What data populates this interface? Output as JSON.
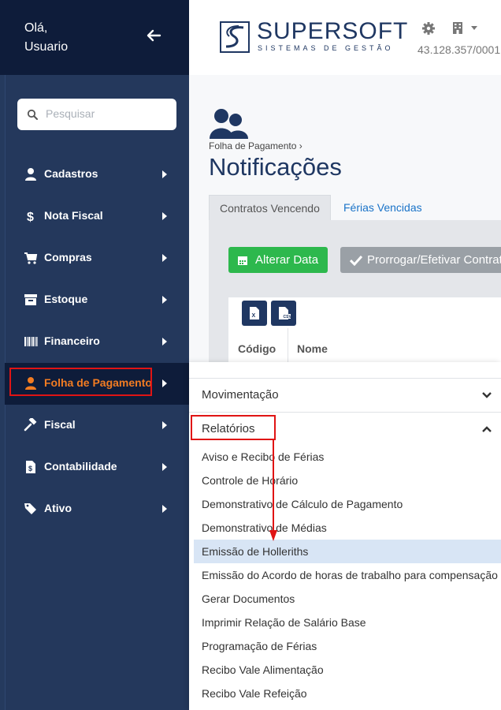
{
  "sidebar": {
    "greeting_line1": "Olá,",
    "greeting_line2": "Usuario",
    "search_placeholder": "Pesquisar",
    "items": [
      {
        "label": "Cadastros",
        "icon": "user-icon"
      },
      {
        "label": "Nota Fiscal",
        "icon": "dollar-icon"
      },
      {
        "label": "Compras",
        "icon": "cart-icon"
      },
      {
        "label": "Estoque",
        "icon": "archive-icon"
      },
      {
        "label": "Financeiro",
        "icon": "barcode-icon"
      },
      {
        "label": "Folha de Pagamento",
        "icon": "user-icon",
        "active": true
      },
      {
        "label": "Fiscal",
        "icon": "gavel-icon"
      },
      {
        "label": "Contabilidade",
        "icon": "file-dollar-icon"
      },
      {
        "label": "Ativo",
        "icon": "tags-icon"
      }
    ]
  },
  "header": {
    "brand": "SUPERSOFT",
    "brand_sub": "SISTEMAS DE GESTÃO",
    "company_id": "43.128.357/0001"
  },
  "main": {
    "breadcrumb": "Folha de Pagamento",
    "title": "Notificações",
    "tabs": [
      {
        "label": "Contratos Vencendo",
        "active": true
      },
      {
        "label": "Férias Vencidas",
        "active": false
      }
    ],
    "buttons": {
      "alter_date": "Alterar Data",
      "extend": "Prorrogar/Efetivar Contrat"
    },
    "table_headers": [
      "Código",
      "Nome"
    ]
  },
  "submenu": {
    "sections": [
      {
        "label": "Movimentação",
        "expanded": false
      },
      {
        "label": "Relatórios",
        "expanded": true
      }
    ],
    "links": [
      "Aviso e Recibo de Férias",
      "Controle de Horário",
      "Demonstrativo de Cálculo de Pagamento",
      "Demonstrativo de Médias",
      "Emissão de Holleriths",
      "Emissão do Acordo de horas de trabalho para compensação",
      "Gerar Documentos",
      "Imprimir Relação de Salário Base",
      "Programação de Férias",
      "Recibo Vale Alimentação",
      "Recibo Vale Refeição"
    ],
    "highlighted_index": 4
  },
  "colors": {
    "sidebar": "#24385c",
    "sidebar_dark": "#0e1c3a",
    "active_label": "#f27c22",
    "brand": "#1f3762",
    "green": "#2db84d",
    "annotation_red": "#e01414"
  }
}
